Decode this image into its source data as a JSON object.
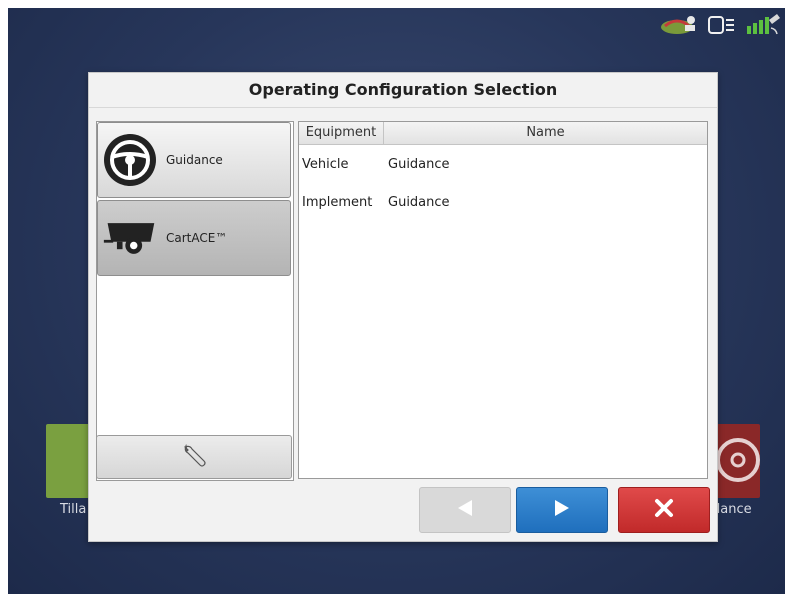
{
  "status_bar": {
    "icons": [
      "field-map-icon",
      "display-unit-icon",
      "gps-signal-icon"
    ]
  },
  "background": {
    "left_app_label": "Tilla",
    "right_app_label": "dance"
  },
  "dialog": {
    "title": "Operating Configuration Selection",
    "configurations": [
      {
        "label": "Guidance",
        "icon": "steering-wheel-icon",
        "selected": false
      },
      {
        "label": "CartACE™",
        "icon": "grain-cart-icon",
        "selected": true
      }
    ],
    "settings_icon": "wrench-icon",
    "table": {
      "columns": [
        "Equipment",
        "Name"
      ],
      "rows": [
        {
          "equipment": "Vehicle",
          "name": "Guidance"
        },
        {
          "equipment": "Implement",
          "name": "Guidance"
        }
      ]
    },
    "buttons": {
      "previous_icon": "arrow-left-icon",
      "next_icon": "arrow-right-icon",
      "cancel_icon": "close-icon"
    }
  },
  "colors": {
    "accent_blue": "#1f6fbd",
    "cancel_red": "#c12a2a",
    "background": "#27365a"
  }
}
